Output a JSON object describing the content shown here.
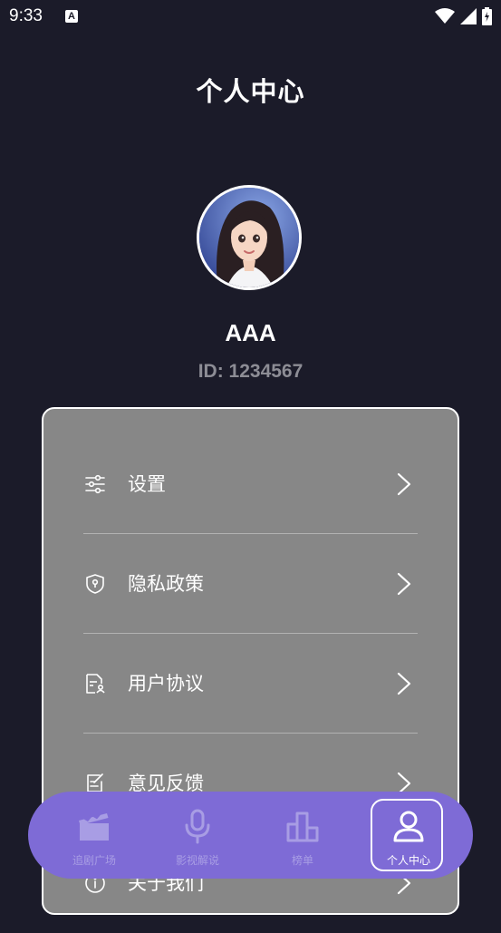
{
  "status": {
    "time": "9:33",
    "notif_icon": "A"
  },
  "header": {
    "title": "个人中心"
  },
  "profile": {
    "name": "AAA",
    "id_text": "ID: 1234567"
  },
  "menu": [
    {
      "label": "设置",
      "icon": "sliders-icon"
    },
    {
      "label": "隐私政策",
      "icon": "shield-lock-icon"
    },
    {
      "label": "用户协议",
      "icon": "document-user-icon"
    },
    {
      "label": "意见反馈",
      "icon": "edit-note-icon"
    },
    {
      "label": "关于我们",
      "icon": "info-icon"
    }
  ],
  "tabs": [
    {
      "label": "追剧广场",
      "icon": "clapperboard-icon"
    },
    {
      "label": "影视解说",
      "icon": "microphone-icon"
    },
    {
      "label": "榜单",
      "icon": "bar-chart-icon"
    },
    {
      "label": "个人中心",
      "icon": "user-icon",
      "active": true
    }
  ],
  "colors": {
    "background": "#1b1b29",
    "card": "#878787",
    "tabbar": "#7e6bd6",
    "id_text": "#8d8d95"
  }
}
